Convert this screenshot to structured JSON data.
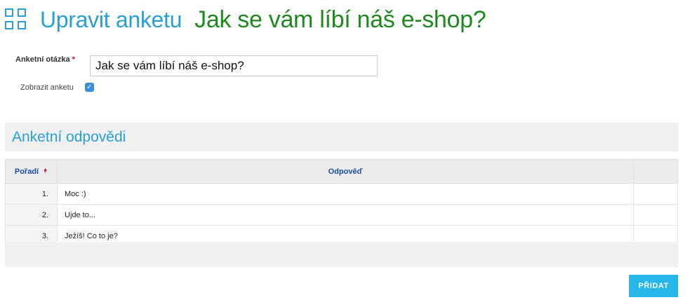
{
  "header": {
    "icon": "grid-icon",
    "title": "Upravit anketu",
    "subtitle": "Jak se vám líbí náš e-shop?"
  },
  "form": {
    "question_label": "Anketní otázka",
    "required_mark": "*",
    "question_value": "Jak se vám líbí náš e-shop?",
    "show_label": "Zobrazit anketu",
    "show_checked": true
  },
  "answers_section": {
    "title": "Anketní odpovědi",
    "columns": {
      "order": "Pořadí",
      "answer": "Odpověď",
      "extra": ""
    },
    "rows": [
      {
        "order": "1.",
        "answer": "Moc :)"
      },
      {
        "order": "2.",
        "answer": "Ujde to..."
      },
      {
        "order": "3.",
        "answer": "Ježíš! Co to je?"
      }
    ]
  },
  "actions": {
    "add_label": "PŘIDAT"
  },
  "colors": {
    "accent": "#2a9fd6",
    "subtitle": "#1e8a1e",
    "button": "#27b6e8"
  }
}
